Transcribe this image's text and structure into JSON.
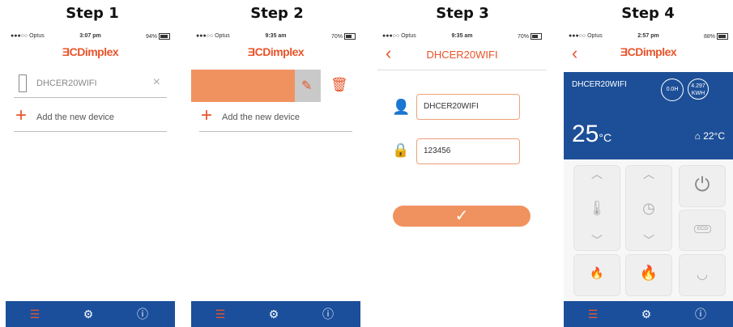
{
  "steps": [
    "Step 1",
    "Step 2",
    "Step 3",
    "Step 4"
  ],
  "colors": {
    "accent": "#e8542a",
    "nav": "#1b4f9b",
    "swipe": "#f0925f",
    "blue_panel": "#1d4f98"
  },
  "phone1": {
    "status": {
      "carrier": "●●●○○ Optus",
      "time": "3:07 pm",
      "battery": "94%"
    },
    "logo": "Dimplex",
    "device": "DHCER20WIFI",
    "add_label": "Add the new device"
  },
  "phone2": {
    "status": {
      "carrier": "●●●○○ Optus",
      "time": "9:35 am",
      "battery": "70%"
    },
    "logo": "Dimplex",
    "add_label": "Add the new device"
  },
  "phone3": {
    "status": {
      "carrier": "●●●○○ Optus",
      "time": "9:35 am",
      "battery": "70%"
    },
    "title": "DHCER20WIFI",
    "name_value": "DHCER20WIFI",
    "password_value": "123456"
  },
  "phone4": {
    "status": {
      "carrier": "●●●○○ Optus",
      "time": "2:57 pm",
      "battery": "88%"
    },
    "logo": "Dimplex",
    "device": "DHCER20WIFI",
    "hours": "0.0H",
    "energy": "4.297 KWH",
    "energy_top": "4.297",
    "energy_bot": "KWH",
    "set_temp": "25",
    "set_unit": "°C",
    "room_temp": "22°C",
    "eco": "ECO"
  },
  "tabs": {
    "list_icon": "list-icon",
    "settings_icon": "gear-icon",
    "info_icon": "info-icon"
  }
}
